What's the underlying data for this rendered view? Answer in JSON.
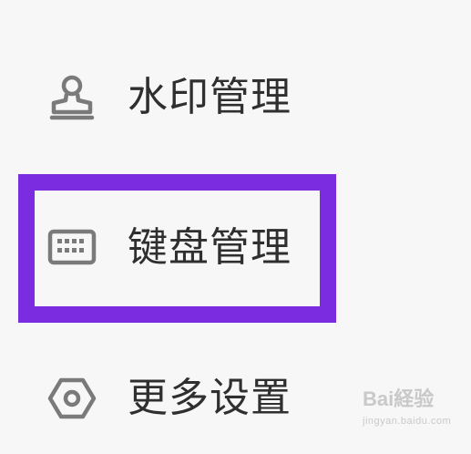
{
  "menu": {
    "items": [
      {
        "label": "水印管理",
        "icon": "stamp-icon"
      },
      {
        "label": "键盘管理",
        "icon": "keyboard-icon"
      },
      {
        "label": "更多设置",
        "icon": "hex-settings-icon"
      }
    ]
  },
  "highlight": {
    "color": "#7b2ce0",
    "target": "键盘管理"
  },
  "watermark": {
    "brand": "Bai経验",
    "site": "jingyan.baidu.com"
  },
  "colors": {
    "background": "#f7f7f7",
    "text": "#2f2f2f",
    "icon": "#7a7a7a"
  }
}
